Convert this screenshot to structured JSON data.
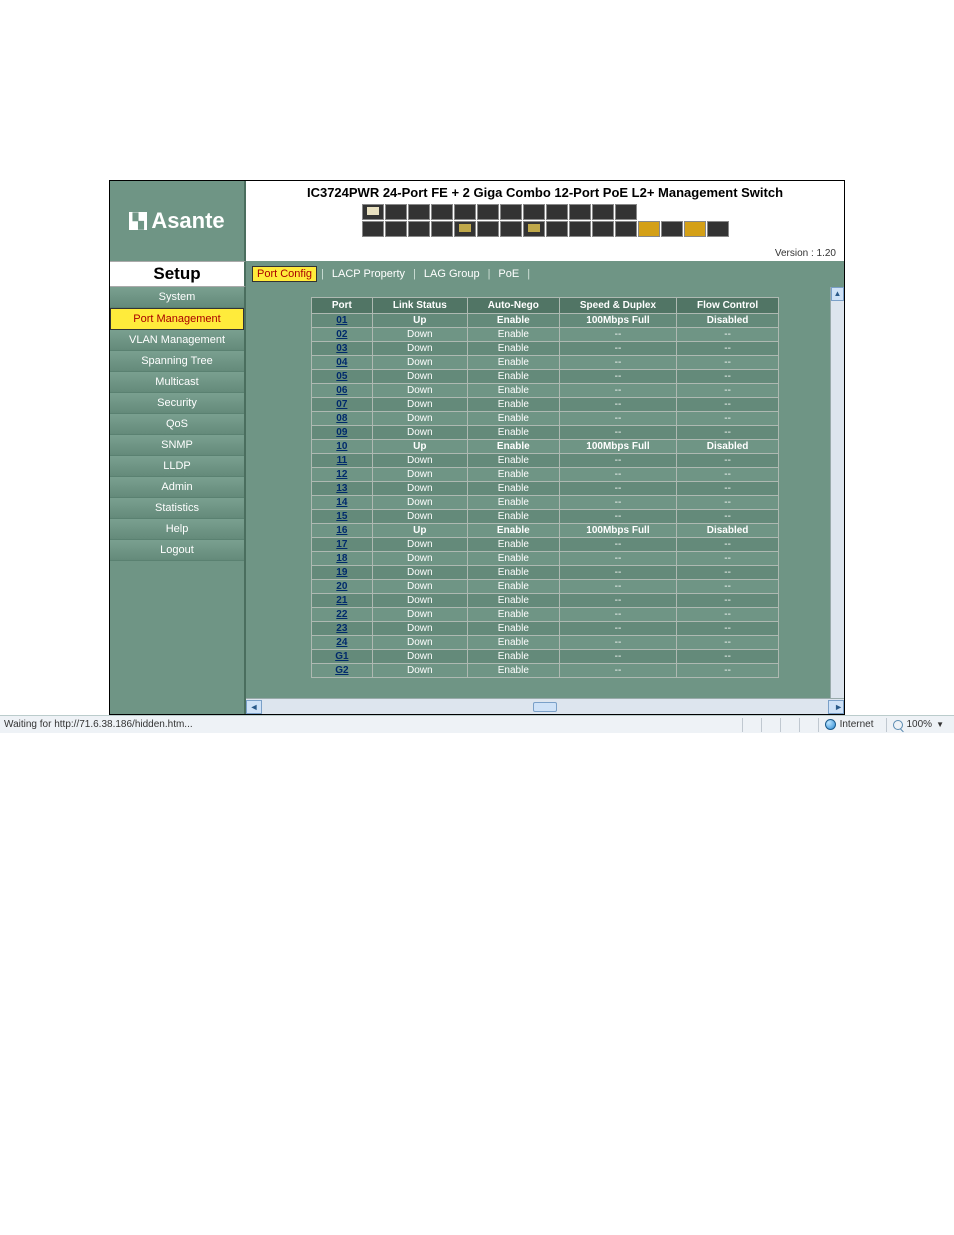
{
  "brand": "Asante",
  "header": {
    "title": "IC3724PWR 24-Port FE + 2 Giga Combo 12-Port PoE L2+ Management Switch",
    "version": "Version : 1.20"
  },
  "setup_label": "Setup",
  "tabs": [
    {
      "label": "Port Config",
      "active": true
    },
    {
      "label": "LACP Property",
      "active": false
    },
    {
      "label": "LAG Group",
      "active": false
    },
    {
      "label": "PoE",
      "active": false
    }
  ],
  "sidebar": [
    {
      "label": "System",
      "active": false
    },
    {
      "label": "Port Management",
      "active": true
    },
    {
      "label": "VLAN Management",
      "active": false
    },
    {
      "label": "Spanning Tree",
      "active": false
    },
    {
      "label": "Multicast",
      "active": false
    },
    {
      "label": "Security",
      "active": false
    },
    {
      "label": "QoS",
      "active": false
    },
    {
      "label": "SNMP",
      "active": false
    },
    {
      "label": "LLDP",
      "active": false
    },
    {
      "label": "Admin",
      "active": false
    },
    {
      "label": "Statistics",
      "active": false
    },
    {
      "label": "Help",
      "active": false
    },
    {
      "label": "Logout",
      "active": false
    }
  ],
  "table": {
    "headers": [
      "Port",
      "Link Status",
      "Auto-Nego",
      "Speed & Duplex",
      "Flow Control"
    ],
    "rows": [
      {
        "port": "01",
        "link": "Up",
        "auto": "Enable",
        "speed": "100Mbps Full",
        "flow": "Disabled"
      },
      {
        "port": "02",
        "link": "Down",
        "auto": "Enable",
        "speed": "--",
        "flow": "--"
      },
      {
        "port": "03",
        "link": "Down",
        "auto": "Enable",
        "speed": "--",
        "flow": "--"
      },
      {
        "port": "04",
        "link": "Down",
        "auto": "Enable",
        "speed": "--",
        "flow": "--"
      },
      {
        "port": "05",
        "link": "Down",
        "auto": "Enable",
        "speed": "--",
        "flow": "--"
      },
      {
        "port": "06",
        "link": "Down",
        "auto": "Enable",
        "speed": "--",
        "flow": "--"
      },
      {
        "port": "07",
        "link": "Down",
        "auto": "Enable",
        "speed": "--",
        "flow": "--"
      },
      {
        "port": "08",
        "link": "Down",
        "auto": "Enable",
        "speed": "--",
        "flow": "--"
      },
      {
        "port": "09",
        "link": "Down",
        "auto": "Enable",
        "speed": "--",
        "flow": "--"
      },
      {
        "port": "10",
        "link": "Up",
        "auto": "Enable",
        "speed": "100Mbps Full",
        "flow": "Disabled"
      },
      {
        "port": "11",
        "link": "Down",
        "auto": "Enable",
        "speed": "--",
        "flow": "--"
      },
      {
        "port": "12",
        "link": "Down",
        "auto": "Enable",
        "speed": "--",
        "flow": "--"
      },
      {
        "port": "13",
        "link": "Down",
        "auto": "Enable",
        "speed": "--",
        "flow": "--"
      },
      {
        "port": "14",
        "link": "Down",
        "auto": "Enable",
        "speed": "--",
        "flow": "--"
      },
      {
        "port": "15",
        "link": "Down",
        "auto": "Enable",
        "speed": "--",
        "flow": "--"
      },
      {
        "port": "16",
        "link": "Up",
        "auto": "Enable",
        "speed": "100Mbps Full",
        "flow": "Disabled"
      },
      {
        "port": "17",
        "link": "Down",
        "auto": "Enable",
        "speed": "--",
        "flow": "--"
      },
      {
        "port": "18",
        "link": "Down",
        "auto": "Enable",
        "speed": "--",
        "flow": "--"
      },
      {
        "port": "19",
        "link": "Down",
        "auto": "Enable",
        "speed": "--",
        "flow": "--"
      },
      {
        "port": "20",
        "link": "Down",
        "auto": "Enable",
        "speed": "--",
        "flow": "--"
      },
      {
        "port": "21",
        "link": "Down",
        "auto": "Enable",
        "speed": "--",
        "flow": "--"
      },
      {
        "port": "22",
        "link": "Down",
        "auto": "Enable",
        "speed": "--",
        "flow": "--"
      },
      {
        "port": "23",
        "link": "Down",
        "auto": "Enable",
        "speed": "--",
        "flow": "--"
      },
      {
        "port": "24",
        "link": "Down",
        "auto": "Enable",
        "speed": "--",
        "flow": "--"
      },
      {
        "port": "G1",
        "link": "Down",
        "auto": "Enable",
        "speed": "--",
        "flow": "--"
      },
      {
        "port": "G2",
        "link": "Down",
        "auto": "Enable",
        "speed": "--",
        "flow": "--"
      }
    ]
  },
  "statusbar": {
    "loading": "Waiting for http://71.6.38.186/hidden.htm...",
    "zone": "Internet",
    "zoom": "100%"
  }
}
